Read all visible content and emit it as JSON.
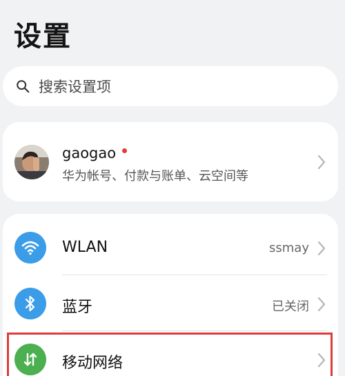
{
  "header": {
    "title": "设置"
  },
  "search": {
    "placeholder": "搜索设置项",
    "icon": "search-icon"
  },
  "account": {
    "name": "gaogao",
    "subtitle": "华为帐号、付款与账单、云空间等",
    "has_notification_dot": true
  },
  "settings": [
    {
      "label": "WLAN",
      "value": "ssmay",
      "icon": "wifi-icon",
      "icon_color": "#3b9ce8"
    },
    {
      "label": "蓝牙",
      "value": "已关闭",
      "icon": "bluetooth-icon",
      "icon_color": "#3b9ce8"
    },
    {
      "label": "移动网络",
      "value": "",
      "icon": "mobile-data-icon",
      "icon_color": "#4caf50"
    }
  ],
  "colors": {
    "background": "#f1f2f4",
    "card": "#ffffff",
    "highlight": "#e03a3a",
    "notification_dot": "#e53935"
  }
}
